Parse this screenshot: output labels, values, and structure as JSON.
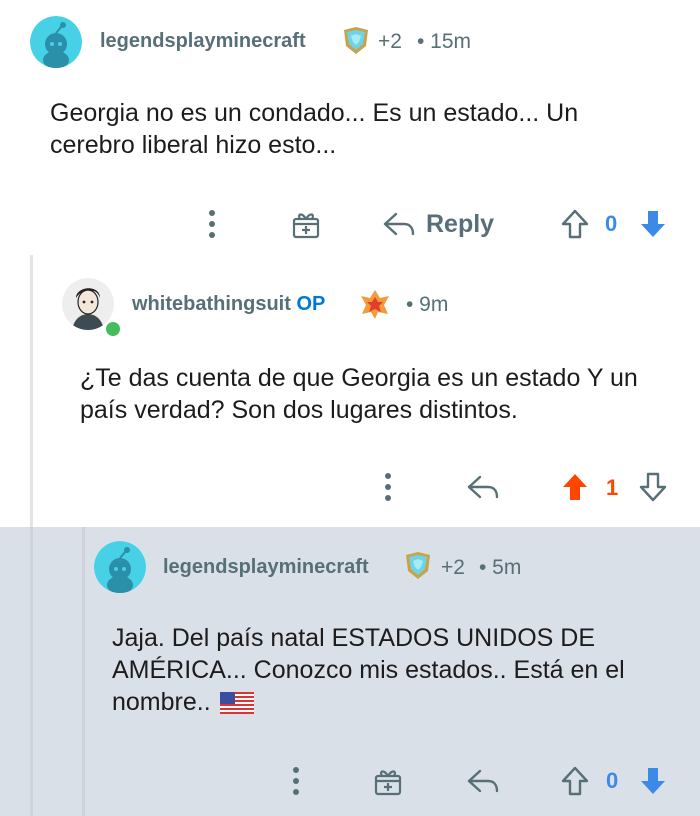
{
  "colors": {
    "username": "#576f76",
    "op_blue": "#0079d3",
    "upvote_orange": "#ff4500",
    "downvote_blue": "#3b8ae8",
    "count_blue": "#3b8ae8",
    "count_orange": "#ff4500",
    "highlight_bg": "#dae0e7"
  },
  "comments": [
    {
      "username": "legendsplayminecraft",
      "flair": "+2",
      "time": "• 15m",
      "text_line1": "Georgia no es un condado... Es un estado... Un",
      "text_line2": "cerebro liberal hizo esto...",
      "reply_label": "Reply",
      "score": "0",
      "vote_state": "downvoted"
    },
    {
      "username": "whitebathingsuit",
      "op_label": "OP",
      "time": "• 9m",
      "text_line1": "¿Te das cuenta de que Georgia es un estado Y un",
      "text_line2": "país verdad? Son dos lugares distintos.",
      "score": "1",
      "vote_state": "upvoted"
    },
    {
      "username": "legendsplayminecraft",
      "flair": "+2",
      "time": "• 5m",
      "text_line1": "Jaja. Del país natal ESTADOS UNIDOS DE",
      "text_line2": "AMÉRICA... Conozco mis estados.. Está en el",
      "text_line3": "nombre..",
      "flag_icon": "us-flag-emoji",
      "score": "0",
      "vote_state": "downvoted"
    }
  ]
}
